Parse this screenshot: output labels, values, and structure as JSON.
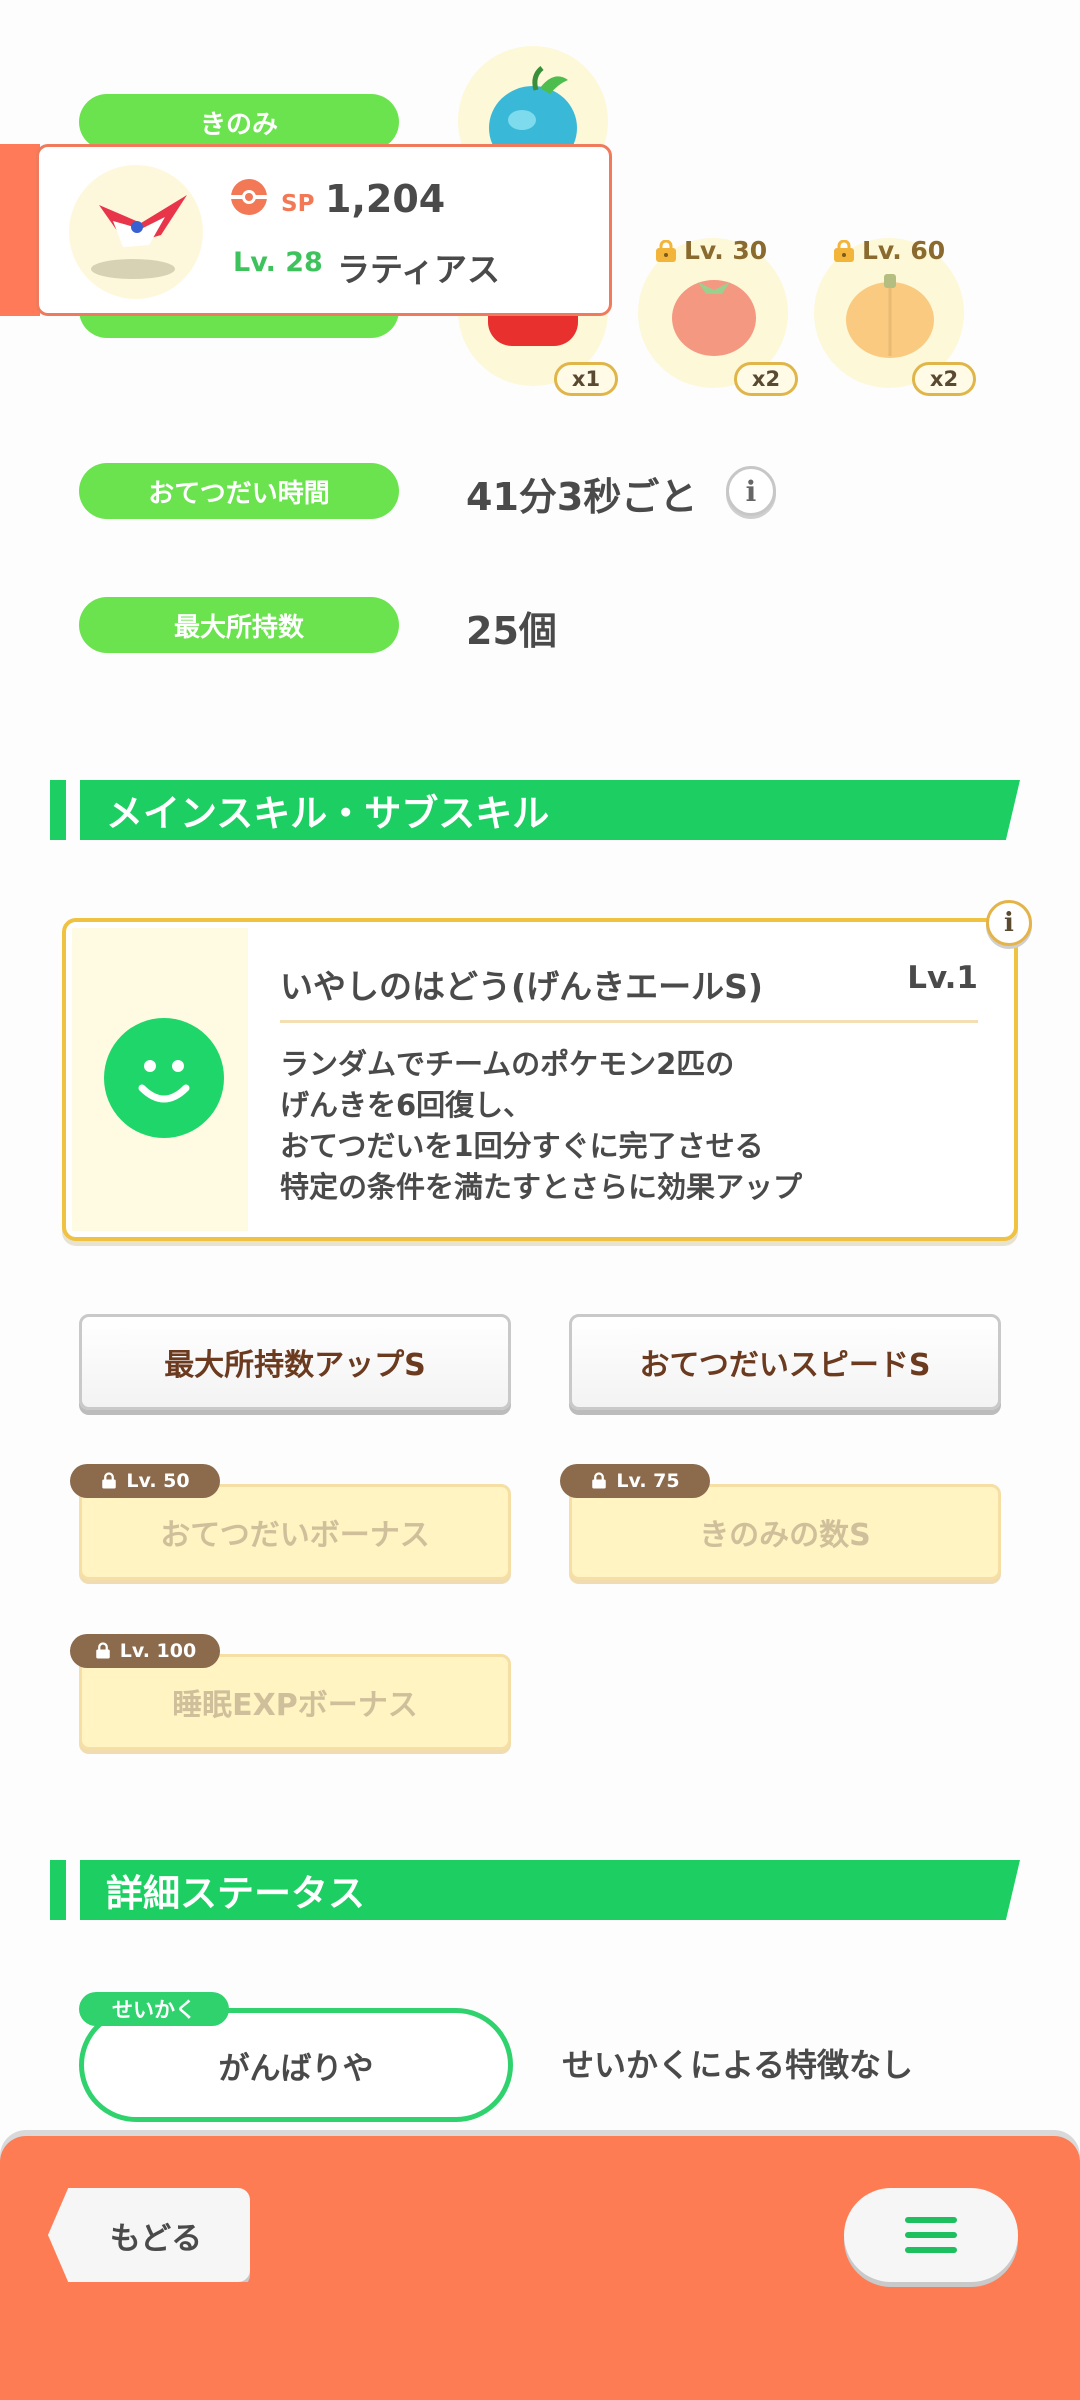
{
  "ingredients": {
    "pill_label": "きのみ",
    "items": [
      {
        "icon": "red-berry-icon",
        "count": "x1",
        "lock": ""
      },
      {
        "icon": "tomato-icon",
        "count": "x2",
        "lock": "Lv. 30"
      },
      {
        "icon": "pumpkin-icon",
        "count": "x2",
        "lock": "Lv. 60"
      }
    ]
  },
  "help_time": {
    "label": "おてつだい時間",
    "value": "41分3秒ごと"
  },
  "max_carry": {
    "label": "最大所持数",
    "value": "25個"
  },
  "pokemon": {
    "sp_label": "SP",
    "sp_value": "1,204",
    "level": "Lv. 28",
    "name": "ラティアス"
  },
  "skills_section": {
    "title": "メインスキル・サブスキル"
  },
  "main_skill": {
    "name": "いやしのはどう(げんきエールS)",
    "level": "Lv.1",
    "desc": [
      "ランダムでチームのポケモン2匹の",
      "げんきを6回復し、",
      "おてつだいを1回分すぐに完了させる",
      "特定の条件を満たすとさらに効果アップ"
    ]
  },
  "sub_skills": [
    {
      "label": "最大所持数アップS",
      "lock": ""
    },
    {
      "label": "おてつだいスピードS",
      "lock": ""
    },
    {
      "label": "おてつだいボーナス",
      "lock": "Lv. 50"
    },
    {
      "label": "きのみの数S",
      "lock": "Lv. 75"
    },
    {
      "label": "睡眠EXPボーナス",
      "lock": "Lv. 100"
    }
  ],
  "details_section": {
    "title": "詳細ステータス"
  },
  "nature": {
    "tag": "せいかく",
    "value": "がんばりや",
    "effect": "せいかくによる特徴なし"
  },
  "nav": {
    "back_label": "もどる"
  },
  "colors": {
    "accent_green": "#1dcf63",
    "pill_green": "#6be34e",
    "bottom_bar": "#fd7c54"
  }
}
